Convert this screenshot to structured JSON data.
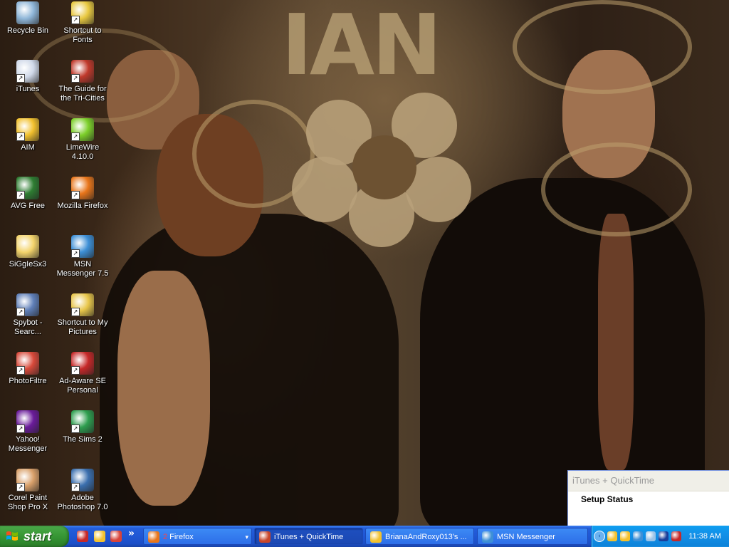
{
  "desktop": {
    "icons": [
      {
        "label": "Recycle Bin",
        "icon": "recycle-bin-icon",
        "color": "#8fb6d8"
      },
      {
        "label": "Shortcut to Fonts",
        "icon": "fonts-folder-icon",
        "color": "#e8c840"
      },
      {
        "label": "iTunes",
        "icon": "itunes-icon",
        "color": "#cfd8e8"
      },
      {
        "label": "The Guide for the Tri-Cities",
        "icon": "guide-icon",
        "color": "#c0392b"
      },
      {
        "label": "AIM",
        "icon": "aim-icon",
        "color": "#f2c12e"
      },
      {
        "label": "LimeWire 4.10.0",
        "icon": "limewire-icon",
        "color": "#7ccf2a"
      },
      {
        "label": "AVG Free",
        "icon": "avg-icon",
        "color": "#2e7d32"
      },
      {
        "label": "Mozilla Firefox",
        "icon": "firefox-icon",
        "color": "#e8751a"
      },
      {
        "label": "SiGgIeSx3",
        "icon": "folder-icon",
        "color": "#f3d36b"
      },
      {
        "label": "MSN Messenger 7.5",
        "icon": "msn-messenger-icon",
        "color": "#3d8fd6"
      },
      {
        "label": "Spybot - Searc...",
        "icon": "spybot-icon",
        "color": "#5f7fb8"
      },
      {
        "label": "Shortcut to My Pictures",
        "icon": "my-pictures-icon",
        "color": "#e8c64a"
      },
      {
        "label": "PhotoFiltre",
        "icon": "photofiltre-icon",
        "color": "#d8493a"
      },
      {
        "label": "Ad-Aware SE Personal",
        "icon": "ad-aware-icon",
        "color": "#c62828"
      },
      {
        "label": "Yahoo! Messenger",
        "icon": "yahoo-messenger-icon",
        "color": "#6a1b9a"
      },
      {
        "label": "The Sims 2",
        "icon": "sims-icon",
        "color": "#2e9e4f"
      },
      {
        "label": "Corel Paint Shop Pro X",
        "icon": "corel-paint-shop-icon",
        "color": "#d9a06a"
      },
      {
        "label": "Adobe Photoshop 7.0",
        "icon": "photoshop-icon",
        "color": "#3b6fae"
      }
    ]
  },
  "wallpaper": {
    "text": "IAN"
  },
  "itunes_window": {
    "title": "iTunes + QuickTime",
    "body": "Setup Status"
  },
  "taskbar": {
    "start_label": "start",
    "quick_launch": [
      {
        "icon": "quicklaunch-adaware-icon",
        "color": "#c62828"
      },
      {
        "icon": "quicklaunch-aim-icon",
        "color": "#f2c12e"
      },
      {
        "icon": "quicklaunch-mushroom-icon",
        "color": "#d8433a"
      }
    ],
    "quick_launch_more": "»",
    "buttons": [
      {
        "count": "2",
        "label": "Firefox",
        "icon": "firefox-task-icon",
        "color": "#e8751a",
        "has_dropdown": "▾"
      },
      {
        "label": "iTunes + QuickTime",
        "icon": "itunes-setup-task-icon",
        "color": "#c8452a"
      },
      {
        "label": "BrianaAndRoxy013's ...",
        "icon": "aim-chat-task-icon",
        "color": "#f2c12e"
      },
      {
        "label": "MSN Messenger",
        "icon": "msn-task-icon",
        "color": "#3d8fd6"
      }
    ],
    "tray": {
      "chevron": "‹",
      "icons": [
        {
          "icon": "tray-aim-icon",
          "color": "#f2c12e"
        },
        {
          "icon": "tray-yahoo-icon",
          "color": "#f6c02a"
        },
        {
          "icon": "tray-msn-icon",
          "color": "#3d8fd6"
        },
        {
          "icon": "tray-network-icon",
          "color": "#9ac3e8"
        },
        {
          "icon": "tray-security-icon",
          "color": "#1a3e9a"
        },
        {
          "icon": "tray-adaware-icon",
          "color": "#c62828"
        }
      ],
      "clock": "11:38 AM"
    }
  }
}
